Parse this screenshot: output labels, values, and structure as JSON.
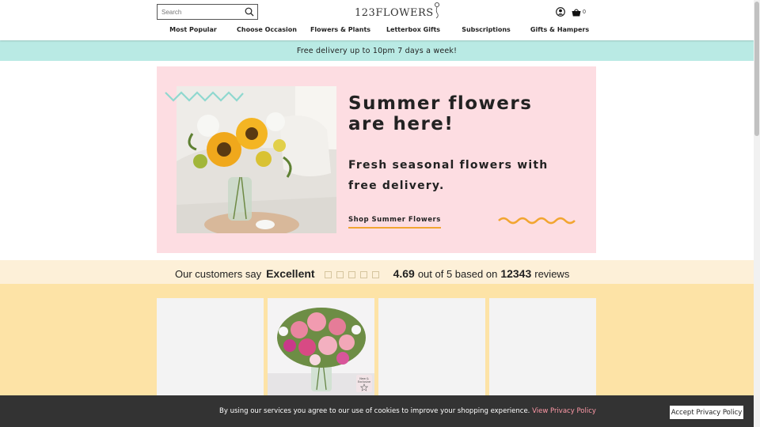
{
  "header": {
    "search": {
      "placeholder": "Search",
      "value": ""
    },
    "logo_text": "123FLOWERS",
    "basket_count": "0"
  },
  "nav": {
    "items": [
      {
        "label": "Most Popular"
      },
      {
        "label": "Choose Occasion"
      },
      {
        "label": "Flowers & Plants"
      },
      {
        "label": "Letterbox Gifts"
      },
      {
        "label": "Subscriptions"
      },
      {
        "label": "Gifts & Hampers"
      }
    ]
  },
  "promo": {
    "text": "Free delivery up to 10pm 7 days a week!"
  },
  "hero": {
    "title": "Summer flowers are here!",
    "subtitle": "Fresh seasonal flowers with free delivery.",
    "cta_label": "Shop Summer Flowers"
  },
  "reviews": {
    "lead": "Our customers say",
    "rating_word": "Excellent",
    "score": "4.69",
    "mid_text": "out of 5 based on",
    "count": "12343",
    "tail_text": "reviews",
    "stars_total": 5
  },
  "products": {
    "badge_line1": "New &",
    "badge_line2": "Exclusive"
  },
  "cookie": {
    "message": "By using our services you agree to our use of cookies to improve your shopping experience.",
    "link_label": "View Privacy Policy",
    "accept_label": "Accept Privacy Policy"
  },
  "colors": {
    "promo_bg": "#b9eae4",
    "hero_bg": "#fddde2",
    "reviews_bg": "#fdf0d8",
    "products_bg": "#fde3a6",
    "cta_underline": "#f2a531",
    "cookie_bg": "#333333",
    "cookie_link": "#ff9aa8"
  },
  "icons": {
    "search": "search-icon",
    "account": "account-icon",
    "basket": "basket-icon",
    "star": "star-icon"
  }
}
